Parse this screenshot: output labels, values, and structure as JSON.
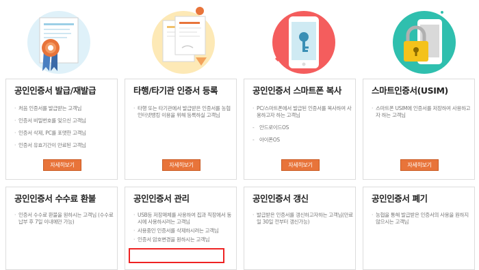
{
  "colors": {
    "accent_orange": "#e8743a",
    "border_gray": "#dcdcdc",
    "highlight_red": "#e22222"
  },
  "icons": [
    "certificate-ribbon-icon",
    "document-transfer-icon",
    "smartphone-key-icon",
    "usim-lock-icon"
  ],
  "cards_top": [
    {
      "title": "공인인증서 발급/재발급",
      "items": [
        "처음 인증서를 발급받는 고객님",
        "인증서 비밀번호를 잊으신 고객님",
        "인증서 삭제, PC를 포맷한 고객님",
        "인증서 유효기간이 만료된 고객님"
      ],
      "button": "자세히보기"
    },
    {
      "title": "타행/타기관 인증서 등록",
      "items": [
        "타행 또는 타기관에서 발급받은 인증서를 농협 인터넷뱅킹 이용을 위해 등록하실 고객님"
      ],
      "button": "자세히보기"
    },
    {
      "title": "공인인증서 스마트폰 복사",
      "items": [
        "PC/스마트폰에서 발급된 인증서를 복사하여 사용하고자 하는 고객님"
      ],
      "subitems": [
        "안드로이드OS",
        "아이폰OS"
      ],
      "button": "자세히보기"
    },
    {
      "title": "스마트인증서(USIM)",
      "items": [
        "스마트폰 USIM에 인증서를 저장하여 사용하고자 하는 고객님"
      ],
      "button": "자세히보기"
    }
  ],
  "cards_bottom": [
    {
      "title": "공인인증서 수수료 환불",
      "items": [
        "인증서 수수료 환불을 원하시는 고객님 (수수료 납부 후 7일 이내에만 가능)"
      ]
    },
    {
      "title": "공인인증서 관리",
      "items": [
        "USB등 저장매체를 사용하여 집과 직장에서 동시에 사용하시려는 고객님",
        "사용중인 인증서를 삭제하시려는 고객님",
        "인증서 암호변경을 원하시는 고객님"
      ]
    },
    {
      "title": "공인인증서 갱신",
      "items": [
        "발급받은 인증서를 갱신하고자하는 고객님(만료일 30일 전부터 갱신가능)"
      ]
    },
    {
      "title": "공인인증서 폐기",
      "items": [
        "농협을 통해 발급받은 인증서의 사용을 원하지 않으시는 고객님"
      ]
    }
  ]
}
